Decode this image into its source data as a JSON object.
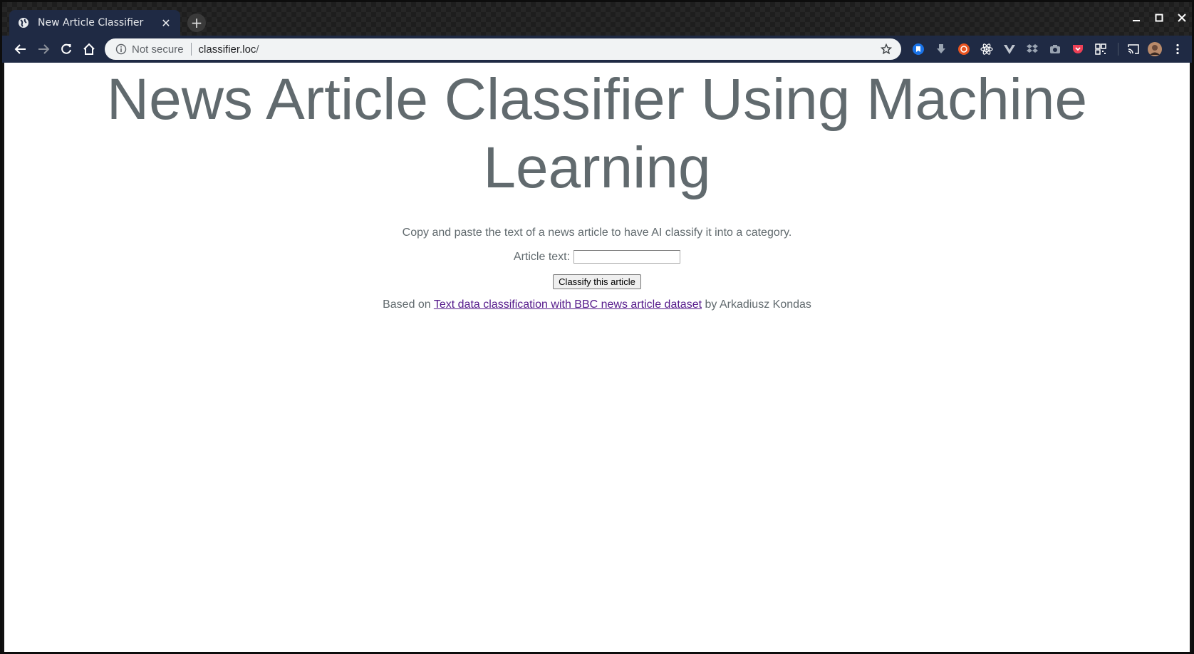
{
  "browser": {
    "tab_title": "New Article Classifier",
    "new_tab_symbol": "+",
    "security_label": "Not secure",
    "url_host": "classifier.loc",
    "url_path": "/",
    "accent_color": "#1f2a44",
    "extension_icons": [
      "bookmark-icon",
      "download-icon",
      "ubuntu-icon",
      "react-icon",
      "vue-icon",
      "dropbox-icon",
      "camera-icon",
      "pocket-icon",
      "qr-code-icon"
    ]
  },
  "page": {
    "title": "News Article Classifier Using Machine Learning",
    "intro": "Copy and paste the text of a news article to have AI classify it into a category.",
    "article_label": "Article text:",
    "article_value": "",
    "submit_label": "Classify this article",
    "credit_prefix": "Based on",
    "credit_link": "Text data classification with BBC news article dataset",
    "credit_suffix": "by Arkadiusz Kondas",
    "text_color": "#616a6e",
    "link_color": "#551a8b"
  }
}
